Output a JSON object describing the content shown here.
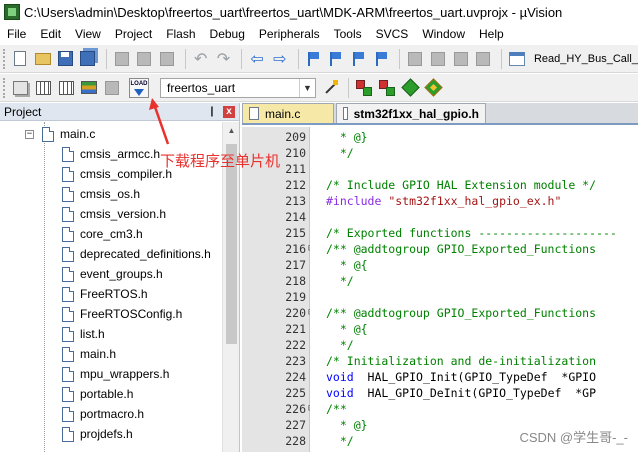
{
  "window": {
    "title": "C:\\Users\\admin\\Desktop\\freertos_uart\\freertos_uart\\MDK-ARM\\freertos_uart.uvprojx - µVision"
  },
  "menu": [
    "File",
    "Edit",
    "View",
    "Project",
    "Flash",
    "Debug",
    "Peripherals",
    "Tools",
    "SVCS",
    "Window",
    "Help"
  ],
  "toolbar": {
    "read_label": "Read_HY_Bus_Call_",
    "target": "freertos_uart",
    "load_label": "LOAD",
    "icons": [
      "new-file-icon",
      "open-folder-icon",
      "save-icon",
      "save-all-icon",
      "cut-icon",
      "copy-icon",
      "paste-icon",
      "undo-icon",
      "redo-icon",
      "nav-back-icon",
      "nav-forward-icon",
      "bookmark-icon",
      "find-icon",
      "window-icon"
    ]
  },
  "project_panel": {
    "title": "Project",
    "pin": "❙",
    "close": "x",
    "group": "main.c",
    "files": [
      "cmsis_armcc.h",
      "cmsis_compiler.h",
      "cmsis_os.h",
      "cmsis_version.h",
      "core_cm3.h",
      "deprecated_definitions.h",
      "event_groups.h",
      "FreeRTOS.h",
      "FreeRTOSConfig.h",
      "list.h",
      "main.h",
      "mpu_wrappers.h",
      "portable.h",
      "portmacro.h",
      "projdefs.h"
    ]
  },
  "editor": {
    "tabs": [
      "main.c",
      "stm32f1xx_hal_gpio.h"
    ],
    "active_tab": "stm32f1xx_hal_gpio.h",
    "lines": [
      {
        "no": "209",
        "fold": "",
        "text": "  * @}",
        "kind": "comment"
      },
      {
        "no": "210",
        "fold": "",
        "text": "  */",
        "kind": "comment"
      },
      {
        "no": "211",
        "fold": "",
        "text": "",
        "kind": "normal"
      },
      {
        "no": "212",
        "fold": "",
        "text": "/* Include GPIO HAL Extension module */",
        "kind": "comment"
      },
      {
        "no": "213",
        "fold": "",
        "text": "#include \"stm32f1xx_hal_gpio_ex.h\"",
        "kind": "include"
      },
      {
        "no": "214",
        "fold": "",
        "text": "",
        "kind": "normal"
      },
      {
        "no": "215",
        "fold": "",
        "text": "/* Exported functions --------------------",
        "kind": "comment"
      },
      {
        "no": "216",
        "fold": "⊟",
        "text": "/** @addtogroup GPIO_Exported_Functions",
        "kind": "comment"
      },
      {
        "no": "217",
        "fold": "",
        "text": "  * @{",
        "kind": "comment"
      },
      {
        "no": "218",
        "fold": "",
        "text": "  */",
        "kind": "comment"
      },
      {
        "no": "219",
        "fold": "",
        "text": "",
        "kind": "normal"
      },
      {
        "no": "220",
        "fold": "⊟",
        "text": "/** @addtogroup GPIO_Exported_Functions",
        "kind": "comment"
      },
      {
        "no": "221",
        "fold": "",
        "text": "  * @{",
        "kind": "comment"
      },
      {
        "no": "222",
        "fold": "",
        "text": "  */",
        "kind": "comment"
      },
      {
        "no": "223",
        "fold": "",
        "text": "/* Initialization and de-initialization",
        "kind": "comment"
      },
      {
        "no": "224",
        "fold": "",
        "text": "void  HAL_GPIO_Init(GPIO_TypeDef  *GPIO",
        "kind": "func"
      },
      {
        "no": "225",
        "fold": "",
        "text": "void  HAL_GPIO_DeInit(GPIO_TypeDef  *GP",
        "kind": "func"
      },
      {
        "no": "226",
        "fold": "⊟",
        "text": "/**",
        "kind": "comment"
      },
      {
        "no": "227",
        "fold": "",
        "text": "  * @}",
        "kind": "comment"
      },
      {
        "no": "228",
        "fold": "",
        "text": "  */",
        "kind": "comment"
      }
    ]
  },
  "annotation": {
    "text": "下载程序至单片机",
    "color": "#e8322e"
  },
  "watermark": "CSDN @学生哥-_-"
}
